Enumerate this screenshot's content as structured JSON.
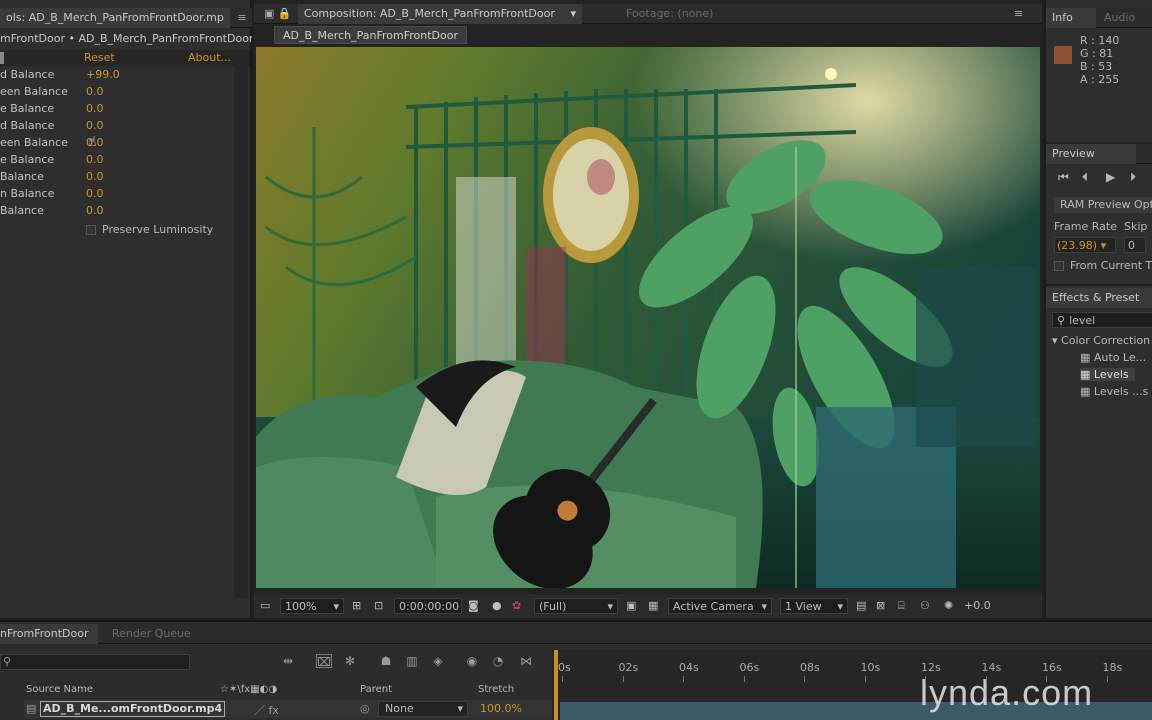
{
  "effect_controls": {
    "tab_title": "ols: AD_B_Merch_PanFromFrontDoor.mp",
    "breadcrumb": "mFrontDoor • AD_B_Merch_PanFromFrontDoor.mp",
    "reset_label": "Reset",
    "about_label": "About...",
    "properties": [
      {
        "label": "d Balance",
        "value": "+99.0"
      },
      {
        "label": "een Balance",
        "value": "0.0"
      },
      {
        "label": "e Balance",
        "value": "0.0"
      },
      {
        "label": "d Balance",
        "value": "0.0"
      },
      {
        "label": "een Balance",
        "value": "0.0"
      },
      {
        "label": "e Balance",
        "value": "0.0"
      },
      {
        "label": "Balance",
        "value": "0.0"
      },
      {
        "label": "n Balance",
        "value": "0.0"
      },
      {
        "label": "Balance",
        "value": "0.0"
      }
    ],
    "preserve_luminosity": "Preserve Luminosity"
  },
  "composition": {
    "tab_label": "Composition: AD_B_Merch_PanFromFrontDoor",
    "footage_tab": "Footage: (none)",
    "comp_name_tab": "AD_B_Merch_PanFromFrontDoor",
    "toolbar": {
      "zoom": "100%",
      "timecode": "0:00:00:00",
      "resolution": "(Full)",
      "camera": "Active Camera",
      "views": "1 View",
      "exposure": "+0.0"
    }
  },
  "info": {
    "tab_info": "Info",
    "tab_audio": "Audio",
    "r": "R : 140",
    "g": "G : 81",
    "b": "B : 53",
    "a": "A : 255",
    "swatch_color": "#8c5135"
  },
  "preview": {
    "title": "Preview",
    "ram_preview": "RAM Preview Opti",
    "frame_rate_label": "Frame Rate",
    "skip_label": "Skip",
    "frame_rate_value": "(23.98)",
    "skip_value": "0",
    "from_current": "From Current Ti"
  },
  "effects_presets": {
    "title": "Effects & Preset",
    "search": "level",
    "category": "Color Correction",
    "items": [
      "Auto Le...",
      "Levels",
      "Levels ...s"
    ]
  },
  "timeline": {
    "tab_comp": "nFromFrontDoor",
    "tab_render": "Render Queue",
    "col_source": "Source Name",
    "col_parent": "Parent",
    "col_stretch": "Stretch",
    "layer_name": "AD_B_Me...omFrontDoor.mp4",
    "layer_parent": "None",
    "layer_stretch": "100.0%",
    "ruler": [
      "0s",
      "02s",
      "04s",
      "06s",
      "08s",
      "10s",
      "12s",
      "14s",
      "16s",
      "18s"
    ]
  },
  "watermark": "lynda.com"
}
